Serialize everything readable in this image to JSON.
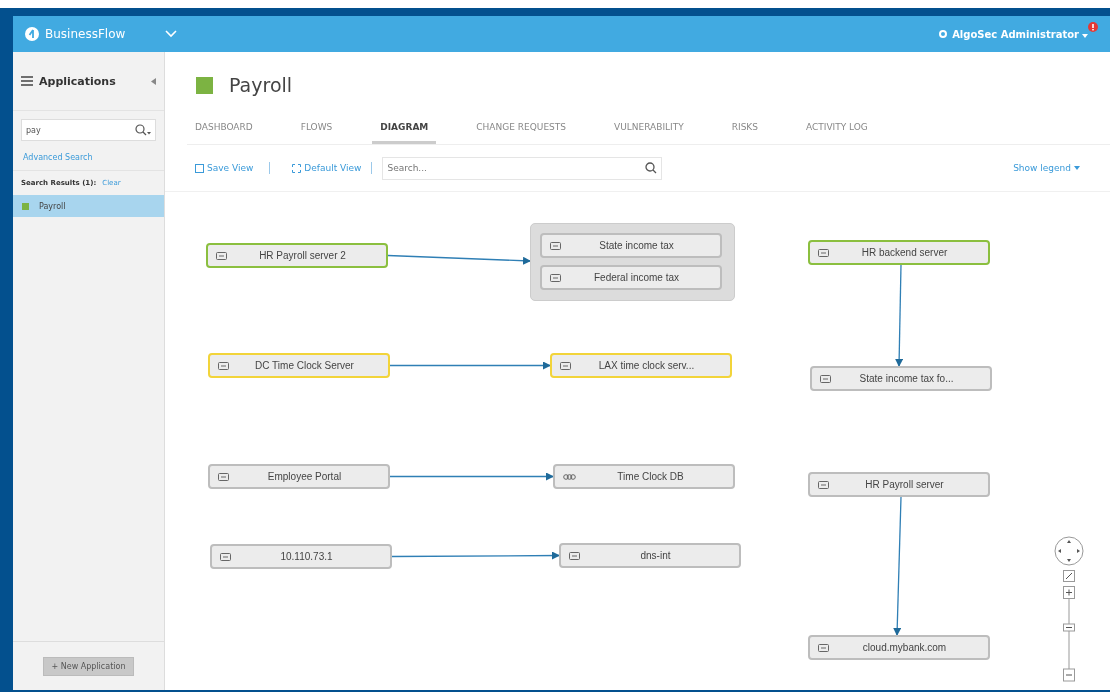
{
  "topbar": {
    "product": "BusinessFlow",
    "user": "AlgoSec Administrator",
    "has_alert": true
  },
  "sidebar": {
    "title": "Applications",
    "search": {
      "value": "pay"
    },
    "advanced_search": "Advanced Search",
    "results_label": "Search Results (1):",
    "clear": "Clear",
    "items": [
      {
        "label": "Payroll",
        "color": "#7cb342",
        "selected": true
      }
    ],
    "new_button": "+ New Application"
  },
  "page": {
    "title": "Payroll",
    "color": "#7cb342"
  },
  "tabs": [
    {
      "label": "DASHBOARD",
      "selected": false
    },
    {
      "label": "FLOWS",
      "selected": false
    },
    {
      "label": "DIAGRAM",
      "selected": true
    },
    {
      "label": "CHANGE REQUESTS",
      "selected": false
    },
    {
      "label": "VULNERABILITY",
      "selected": false
    },
    {
      "label": "RISKS",
      "selected": false
    },
    {
      "label": "ACTIVITY LOG",
      "selected": false
    }
  ],
  "toolbar": {
    "save_view": "Save View",
    "default_view": "Default View",
    "search": {
      "placeholder": "Search..."
    },
    "legend": "Show legend"
  },
  "diagram": {
    "flows": [
      {
        "source": {
          "label": "HR Payroll server 2",
          "kind": "server",
          "color": "#8bbf3f"
        },
        "targets": [
          {
            "label": "State income tax",
            "kind": "server"
          },
          {
            "label": "Federal income tax",
            "kind": "server"
          }
        ]
      },
      {
        "source": {
          "label": "DC Time Clock Server",
          "kind": "server",
          "color": "#f2d43a"
        },
        "targets": [
          {
            "label": "LAX time clock serv...",
            "kind": "server",
            "color": "#f2d43a"
          }
        ]
      },
      {
        "source": {
          "label": "Employee Portal",
          "kind": "server"
        },
        "targets": [
          {
            "label": "Time Clock DB",
            "kind": "database"
          }
        ]
      },
      {
        "source": {
          "label": "10.110.73.1",
          "kind": "server"
        },
        "targets": [
          {
            "label": "dns-int",
            "kind": "server"
          }
        ]
      },
      {
        "source": {
          "label": "HR backend server",
          "kind": "server",
          "color": "#8bbf3f"
        },
        "targets": [
          {
            "label": "State income tax fo...",
            "kind": "server"
          }
        ]
      },
      {
        "source": {
          "label": "HR Payroll server",
          "kind": "server"
        },
        "targets": [
          {
            "label": "cloud.mybank.com",
            "kind": "server"
          }
        ]
      }
    ]
  }
}
